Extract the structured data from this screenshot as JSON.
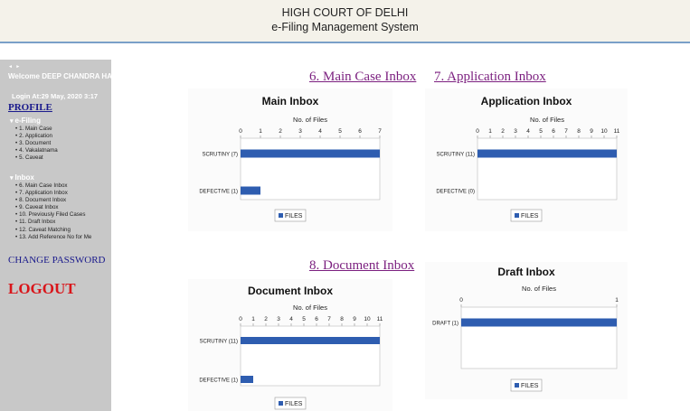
{
  "header": {
    "title": "HIGH COURT OF DELHI",
    "subtitle": "e-Filing Management System"
  },
  "sidebar": {
    "toggle": "◄ ►",
    "welcome": "Welcome  DEEP CHANDRA HARBOLA",
    "login": "Login At:29 May, 2020 3:17",
    "profile": "PROFILE",
    "efiling_label": "e-Filing",
    "efiling_items": [
      "1. Main Case",
      "2. Application",
      "3. Document",
      "4. Vakalatnama",
      "5. Caveat"
    ],
    "inbox_label": "Inbox",
    "inbox_items": [
      "6. Main Case Inbox",
      "7. Application Inbox",
      "8. Document Inbox",
      "9. Caveat Inbox",
      "10. Previously Filed Cases",
      "11. Draft Inbox",
      "12. Caveat Matching",
      "13. Add Reference No for Me"
    ],
    "change_password": "CHANGE PASSWORD",
    "logout": "LOGOUT"
  },
  "links": {
    "main_case_inbox": "6. Main Case Inbox",
    "application_inbox": "7. Application Inbox",
    "document_inbox": "8. Document Inbox"
  },
  "bar_color": "#2e5db0",
  "chart_data": [
    {
      "id": "main",
      "type": "bar",
      "title": "Main Inbox",
      "xlabel": "No. of Files",
      "categories": [
        "SCRUTINY (7)",
        "DEFECTIVE (1)"
      ],
      "series": [
        {
          "name": "FILES",
          "values": [
            7,
            1
          ]
        }
      ],
      "xlim": [
        0,
        7
      ],
      "ticks": [
        0,
        1,
        2,
        3,
        4,
        5,
        6,
        7
      ],
      "grid": false,
      "legend": "bottom"
    },
    {
      "id": "application",
      "type": "bar",
      "title": "Application Inbox",
      "xlabel": "No. of Files",
      "categories": [
        "SCRUTINY (11)",
        "DEFECTIVE (0)"
      ],
      "series": [
        {
          "name": "FILES",
          "values": [
            11,
            0
          ]
        }
      ],
      "xlim": [
        0,
        11
      ],
      "ticks": [
        0,
        1,
        2,
        3,
        4,
        5,
        6,
        7,
        8,
        9,
        10,
        11
      ],
      "grid": false,
      "legend": "bottom"
    },
    {
      "id": "document",
      "type": "bar",
      "title": "Document Inbox",
      "xlabel": "No. of Files",
      "categories": [
        "SCRUTINY (11)",
        "DEFECTIVE (1)"
      ],
      "series": [
        {
          "name": "FILES",
          "values": [
            11,
            1
          ]
        }
      ],
      "xlim": [
        0,
        11
      ],
      "ticks": [
        0,
        1,
        2,
        3,
        4,
        5,
        6,
        7,
        8,
        9,
        10,
        11
      ],
      "grid": false,
      "legend": "bottom"
    },
    {
      "id": "draft",
      "type": "bar",
      "title": "Draft Inbox",
      "xlabel": "No. of Files",
      "categories": [
        "DRAFT (1)"
      ],
      "series": [
        {
          "name": "FILES",
          "values": [
            1
          ]
        }
      ],
      "xlim": [
        0,
        1
      ],
      "ticks": [
        0,
        1
      ],
      "grid": false,
      "legend": "bottom"
    }
  ]
}
